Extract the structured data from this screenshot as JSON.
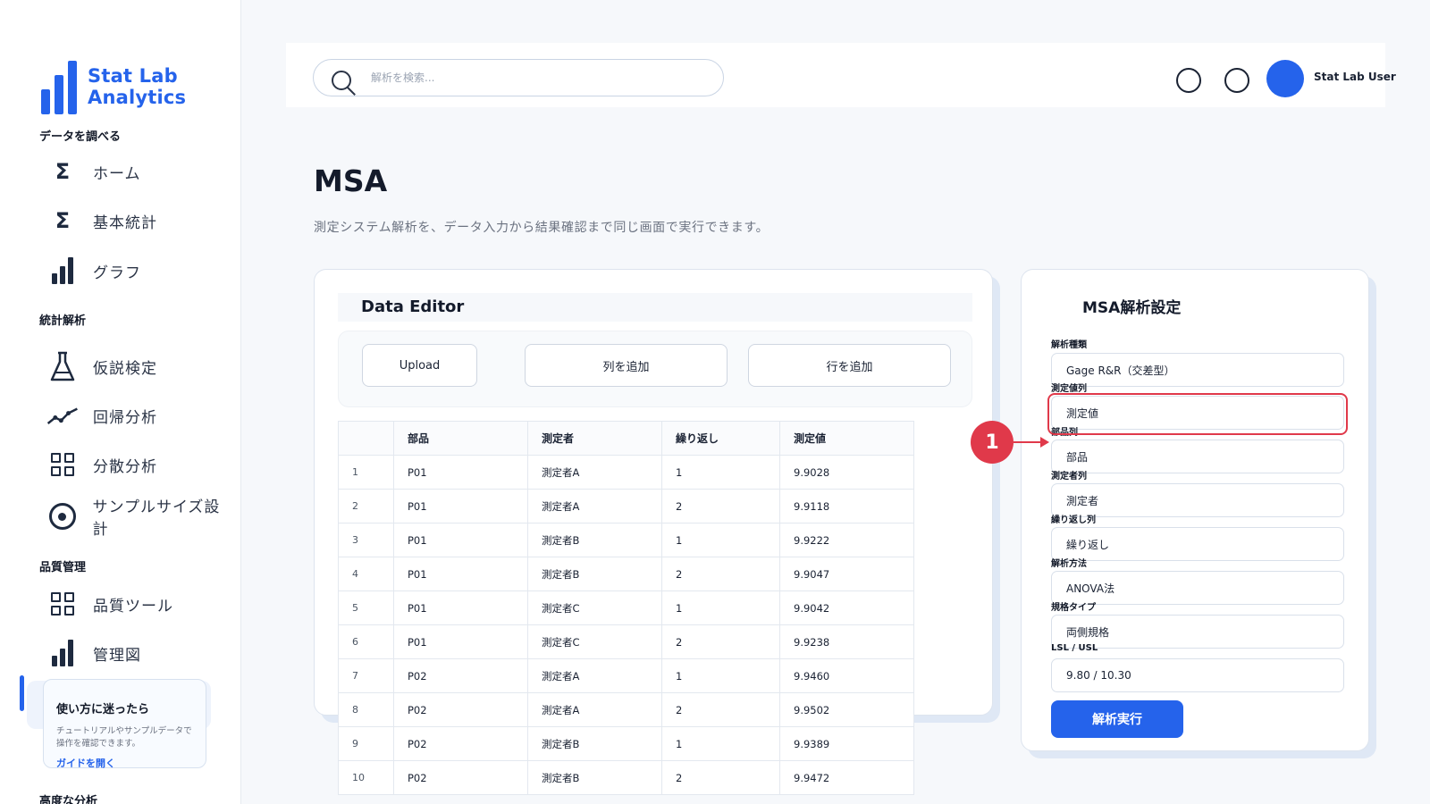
{
  "brand": {
    "name": "Stat Lab Analytics",
    "accent": "#2563eb"
  },
  "sidebar": {
    "sections": [
      {
        "label": "データを調べる"
      },
      {
        "label": "統計解析"
      },
      {
        "label": "品質管理"
      },
      {
        "label": "高度な分析"
      }
    ],
    "items": [
      {
        "label": "ホーム",
        "icon": "sigma-icon"
      },
      {
        "label": "基本統計",
        "icon": "sigma-icon"
      },
      {
        "label": "グラフ",
        "icon": "bar-chart-icon"
      },
      {
        "label": "仮説検定",
        "icon": "flask-icon"
      },
      {
        "label": "回帰分析",
        "icon": "trend-line-icon"
      },
      {
        "label": "分散分析",
        "icon": "grid-icon"
      },
      {
        "label": "サンプルサイズ設計",
        "icon": "target-icon"
      },
      {
        "label": "品質ツール",
        "icon": "grid-icon"
      },
      {
        "label": "管理図",
        "icon": "bar-chart-icon"
      }
    ],
    "help": {
      "title": "使い方に迷ったら",
      "description": "チュートリアルやサンプルデータで操作を確認できます。",
      "link": "ガイドを開く"
    }
  },
  "topbar": {
    "search_placeholder": "解析を検索...",
    "user_name": "Stat Lab User"
  },
  "page": {
    "title": "MSA",
    "subtitle": "測定システム解析を、データ入力から結果確認まで同じ画面で実行できます。"
  },
  "editor": {
    "title": "Data Editor",
    "buttons": {
      "upload": "Upload",
      "add_column": "列を追加",
      "add_row": "行を追加"
    },
    "columns": [
      "",
      "部品",
      "測定者",
      "繰り返し",
      "測定値"
    ],
    "rows": [
      [
        "1",
        "P01",
        "測定者A",
        "1",
        "9.9028"
      ],
      [
        "2",
        "P01",
        "測定者A",
        "2",
        "9.9118"
      ],
      [
        "3",
        "P01",
        "測定者B",
        "1",
        "9.9222"
      ],
      [
        "4",
        "P01",
        "測定者B",
        "2",
        "9.9047"
      ],
      [
        "5",
        "P01",
        "測定者C",
        "1",
        "9.9042"
      ],
      [
        "6",
        "P01",
        "測定者C",
        "2",
        "9.9238"
      ],
      [
        "7",
        "P02",
        "測定者A",
        "1",
        "9.9460"
      ],
      [
        "8",
        "P02",
        "測定者A",
        "2",
        "9.9502"
      ],
      [
        "9",
        "P02",
        "測定者B",
        "1",
        "9.9389"
      ],
      [
        "10",
        "P02",
        "測定者B",
        "2",
        "9.9472"
      ]
    ]
  },
  "settings": {
    "title": "MSA解析設定",
    "fields": [
      {
        "label": "解析種類",
        "value": "Gage R&R（交差型）"
      },
      {
        "label": "測定値列",
        "value": "測定値"
      },
      {
        "label": "部品列",
        "value": "部品"
      },
      {
        "label": "測定者列",
        "value": "測定者"
      },
      {
        "label": "繰り返し列",
        "value": "繰り返し"
      },
      {
        "label": "解析方法",
        "value": "ANOVA法"
      },
      {
        "label": "規格タイプ",
        "value": "両側規格"
      },
      {
        "label": "LSL / USL",
        "value": "9.80 / 10.30"
      }
    ],
    "run_label": "解析実行"
  },
  "callout": {
    "number": "1",
    "color": "#e0394a"
  }
}
